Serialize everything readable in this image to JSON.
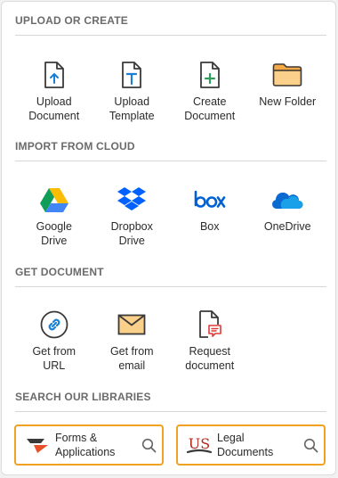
{
  "sections": {
    "upload": {
      "title": "UPLOAD OR CREATE",
      "items": [
        {
          "label": "Upload\nDocument",
          "icon": "upload-document-icon"
        },
        {
          "label": "Upload\nTemplate",
          "icon": "upload-template-icon"
        },
        {
          "label": "Create\nDocument",
          "icon": "create-document-icon"
        },
        {
          "label": "New Folder",
          "icon": "folder-icon"
        }
      ]
    },
    "cloud": {
      "title": "IMPORT FROM CLOUD",
      "items": [
        {
          "label": "Google\nDrive",
          "icon": "google-drive-icon"
        },
        {
          "label": "Dropbox\nDrive",
          "icon": "dropbox-icon"
        },
        {
          "label": "Box",
          "icon": "box-icon"
        },
        {
          "label": "OneDrive",
          "icon": "onedrive-icon"
        }
      ]
    },
    "get": {
      "title": "GET DOCUMENT",
      "items": [
        {
          "label": "Get from\nURL",
          "icon": "link-icon"
        },
        {
          "label": "Get from\nemail",
          "icon": "envelope-icon"
        },
        {
          "label": "Request\ndocument",
          "icon": "request-document-icon"
        }
      ]
    },
    "libraries": {
      "title": "SEARCH OUR LIBRARIES",
      "items": [
        {
          "label": "Forms &\nApplications",
          "icon": "forms-logo-icon"
        },
        {
          "label": "Legal\nDocuments",
          "icon": "us-legal-logo-icon"
        }
      ]
    }
  },
  "colors": {
    "accent_orange": "#f0a11f",
    "icon_blue": "#1a7fd4",
    "icon_green": "#2e9e5b",
    "icon_dark": "#3a3a3a",
    "folder_orange": "#f5a845"
  }
}
